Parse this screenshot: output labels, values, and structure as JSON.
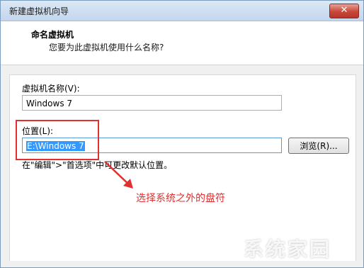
{
  "window": {
    "title": "新建虚拟机向导",
    "close_symbol": "✕"
  },
  "header": {
    "title": "命名虚拟机",
    "subtitle": "您要为此虚拟机使用什么名称?"
  },
  "form": {
    "name_label": "虚拟机名称(V):",
    "name_value": "Windows 7",
    "location_label": "位置(L):",
    "location_value": "E:\\Windows 7",
    "browse_label": "浏览(R)...",
    "hint": "在\"编辑\">\"首选项\"中可更改默认位置。"
  },
  "annotation": {
    "text": "选择系统之外的盘符",
    "color": "#e03030"
  },
  "watermark": {
    "text": "系统家园"
  }
}
